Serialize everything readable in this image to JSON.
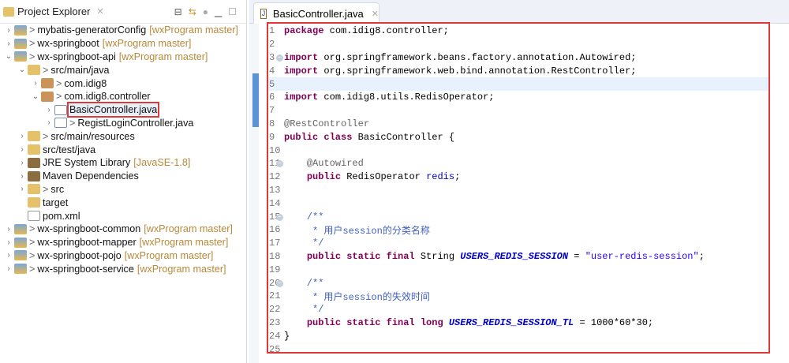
{
  "explorer": {
    "title": "Project Explorer",
    "items": [
      {
        "level": 0,
        "twisty": ">",
        "icon": "proj",
        "label": "mybatis-generatorConfig",
        "git": "[wxProgram master]"
      },
      {
        "level": 0,
        "twisty": ">",
        "icon": "proj",
        "label": "wx-springboot",
        "git": "[wxProgram master]"
      },
      {
        "level": 0,
        "twisty": "v",
        "icon": "proj",
        "label": "wx-springboot-api",
        "git": "[wxProgram master]"
      },
      {
        "level": 1,
        "twisty": "v",
        "icon": "folder",
        "label": "src/main/java"
      },
      {
        "level": 2,
        "twisty": ">",
        "icon": "pkg",
        "label": "com.idig8"
      },
      {
        "level": 2,
        "twisty": "v",
        "icon": "pkg",
        "label": "com.idig8.controller"
      },
      {
        "level": 3,
        "twisty": ">",
        "icon": "java",
        "label": "BasicController.java",
        "selected": true,
        "nodec": true
      },
      {
        "level": 3,
        "twisty": ">",
        "icon": "java",
        "label": "RegistLoginController.java"
      },
      {
        "level": 1,
        "twisty": ">",
        "icon": "folder",
        "label": "src/main/resources"
      },
      {
        "level": 1,
        "twisty": ">",
        "icon": "folder",
        "label": "src/test/java",
        "nodec": true
      },
      {
        "level": 1,
        "twisty": ">",
        "icon": "lib",
        "label": "JRE System Library",
        "git": "[JavaSE-1.8]",
        "nodec": true
      },
      {
        "level": 1,
        "twisty": ">",
        "icon": "lib",
        "label": "Maven Dependencies",
        "nodec": true
      },
      {
        "level": 1,
        "twisty": ">",
        "icon": "folder",
        "label": "src"
      },
      {
        "level": 1,
        "twisty": "",
        "icon": "folder",
        "label": "target",
        "nodec": true
      },
      {
        "level": 1,
        "twisty": "",
        "icon": "xml",
        "label": "pom.xml",
        "nodec": true
      },
      {
        "level": 0,
        "twisty": ">",
        "icon": "proj",
        "label": "wx-springboot-common",
        "git": "[wxProgram master]"
      },
      {
        "level": 0,
        "twisty": ">",
        "icon": "proj",
        "label": "wx-springboot-mapper",
        "git": "[wxProgram master]"
      },
      {
        "level": 0,
        "twisty": ">",
        "icon": "proj",
        "label": "wx-springboot-pojo",
        "git": "[wxProgram master]"
      },
      {
        "level": 0,
        "twisty": ">",
        "icon": "proj",
        "label": "wx-springboot-service",
        "git": "[wxProgram master]"
      }
    ]
  },
  "editor": {
    "tab": "BasicController.java",
    "lines": [
      {
        "n": "1",
        "s": [
          [
            "kw",
            "package"
          ],
          [
            "pl",
            " com.idig8.controller;"
          ]
        ]
      },
      {
        "n": "2",
        "s": []
      },
      {
        "n": "3",
        "fold": true,
        "s": [
          [
            "kw",
            "import"
          ],
          [
            "pl",
            " org.springframework.beans.factory.annotation.Autowired;"
          ]
        ]
      },
      {
        "n": "4",
        "s": [
          [
            "kw",
            "import"
          ],
          [
            "pl",
            " org.springframework.web.bind.annotation.RestController;"
          ]
        ]
      },
      {
        "n": "5",
        "s": []
      },
      {
        "n": "6",
        "s": [
          [
            "kw",
            "import"
          ],
          [
            "pl",
            " com.idig8.utils.RedisOperator;"
          ]
        ]
      },
      {
        "n": "7",
        "s": []
      },
      {
        "n": "8",
        "s": [
          [
            "an",
            "@RestController"
          ]
        ]
      },
      {
        "n": "9",
        "s": [
          [
            "kw",
            "public class"
          ],
          [
            "pl",
            " BasicController {"
          ]
        ]
      },
      {
        "n": "10",
        "s": []
      },
      {
        "n": "11",
        "fold": true,
        "s": [
          [
            "pl",
            "    "
          ],
          [
            "an",
            "@Autowired"
          ]
        ]
      },
      {
        "n": "12",
        "s": [
          [
            "pl",
            "    "
          ],
          [
            "kw",
            "public"
          ],
          [
            "pl",
            " RedisOperator "
          ],
          [
            "fld",
            "redis"
          ],
          [
            "pl",
            ";"
          ]
        ]
      },
      {
        "n": "13",
        "s": []
      },
      {
        "n": "14",
        "s": []
      },
      {
        "n": "15",
        "fold": true,
        "s": [
          [
            "cm",
            "    /**"
          ]
        ]
      },
      {
        "n": "16",
        "s": [
          [
            "cm",
            "     * 用户session的分类名称"
          ]
        ]
      },
      {
        "n": "17",
        "s": [
          [
            "cm",
            "     */"
          ]
        ]
      },
      {
        "n": "18",
        "s": [
          [
            "pl",
            "    "
          ],
          [
            "kw",
            "public static final"
          ],
          [
            "pl",
            " String "
          ],
          [
            "sf",
            "USERS_REDIS_SESSION"
          ],
          [
            "pl",
            " = "
          ],
          [
            "str",
            "\"user-redis-session\""
          ],
          [
            "pl",
            ";"
          ]
        ]
      },
      {
        "n": "19",
        "s": []
      },
      {
        "n": "20",
        "fold": true,
        "s": [
          [
            "cm",
            "    /**"
          ]
        ]
      },
      {
        "n": "21",
        "s": [
          [
            "cm",
            "     * 用户session的失效时间"
          ]
        ]
      },
      {
        "n": "22",
        "s": [
          [
            "cm",
            "     */"
          ]
        ]
      },
      {
        "n": "23",
        "s": [
          [
            "pl",
            "    "
          ],
          [
            "kw",
            "public static final long"
          ],
          [
            "pl",
            " "
          ],
          [
            "sf",
            "USERS_REDIS_SESSION_TL"
          ],
          [
            "pl",
            " = 1000*60*30;"
          ]
        ]
      },
      {
        "n": "24",
        "s": [
          [
            "pl",
            "}"
          ]
        ]
      },
      {
        "n": "25",
        "s": []
      }
    ]
  }
}
